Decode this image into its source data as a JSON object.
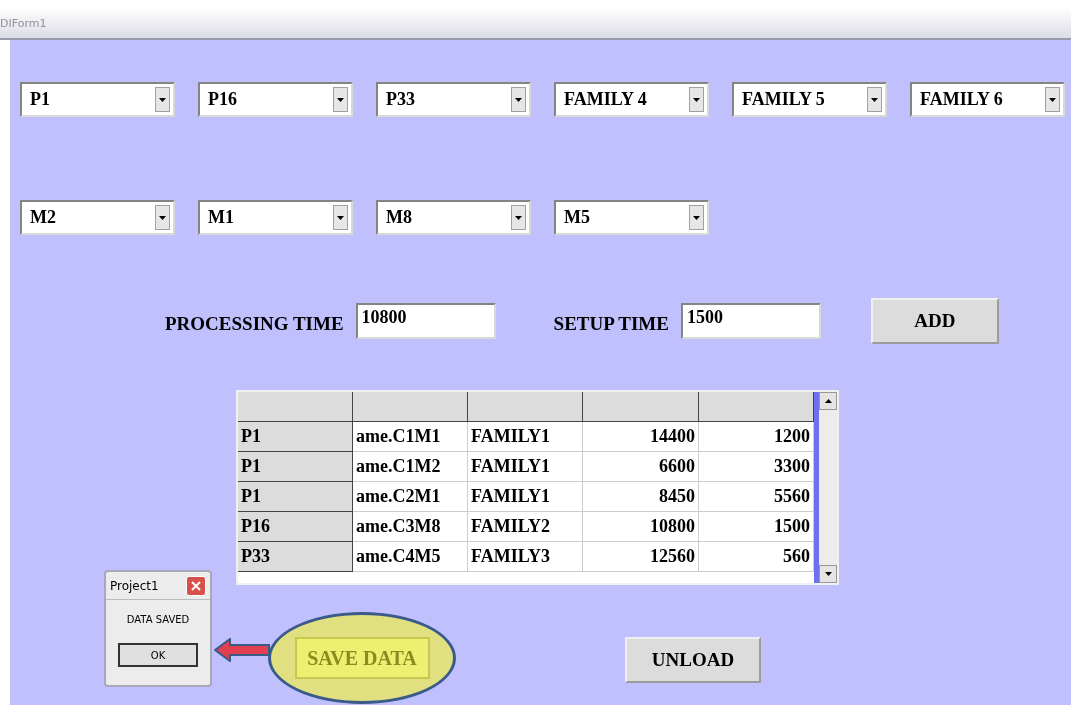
{
  "window": {
    "title": "DIForm1"
  },
  "combo_rows": [
    {
      "combos": [
        {
          "value": "P1"
        },
        {
          "value": "P16"
        },
        {
          "value": "P33"
        },
        {
          "value": "FAMILY  4"
        },
        {
          "value": "FAMILY  5"
        },
        {
          "value": "FAMILY  6"
        }
      ]
    },
    {
      "combos": [
        {
          "value": "M2"
        },
        {
          "value": "M1"
        },
        {
          "value": "M8"
        },
        {
          "value": "M5"
        }
      ]
    }
  ],
  "fields": [
    {
      "label": "PROCESSING TIME",
      "value": "10800"
    },
    {
      "label": "SETUP TIME",
      "value": "1500"
    }
  ],
  "add_button": "ADD",
  "table": {
    "rows": [
      [
        "P1",
        "ame.C1M1",
        "FAMILY1",
        "14400",
        "1200"
      ],
      [
        "P1",
        "ame.C1M2",
        "FAMILY1",
        "6600",
        "3300"
      ],
      [
        "P1",
        "ame.C2M1",
        "FAMILY1",
        "8450",
        "5560"
      ],
      [
        "P16",
        "ame.C3M8",
        "FAMILY2",
        "10800",
        "1500"
      ],
      [
        "P33",
        "ame.C4M5",
        "FAMILY3",
        "12560",
        "560"
      ]
    ]
  },
  "dialog": {
    "title": "Project1",
    "message": "DATA SAVED",
    "button": "OK"
  },
  "save_button": "SAVE DATA",
  "unload_button": "UNLOAD"
}
